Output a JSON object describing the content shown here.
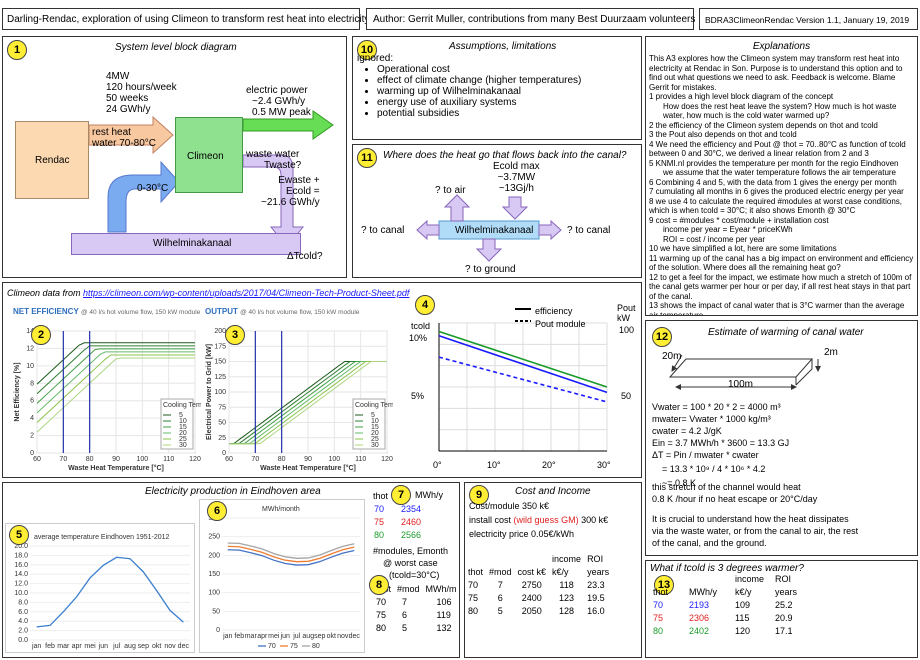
{
  "header": {
    "title": "Darling-Rendac, exploration of using Climeon to transform rest heat into electricity",
    "author": "Author: Gerrit Muller, contributions from many Best Duurzaam volunteers",
    "version": "BDRA3ClimeonRendac Version 1.1, January 19, 2019"
  },
  "block": {
    "num": "1",
    "title": "System level block diagram",
    "rendac": "Rendac",
    "climeon": "Climeon",
    "wilhelmina": "Wilhelminakanaal",
    "input": [
      "4MW",
      "120 hours/week",
      "50 weeks",
      "24 GWh/y"
    ],
    "elec": [
      "electric power",
      "~2.4 GWh/y",
      "0.5 MW peak"
    ],
    "restheat": [
      "rest heat",
      "water 70-80°C"
    ],
    "cold": "0-30°C",
    "waste": [
      "waste water",
      "Twaste?"
    ],
    "ewaste": [
      "Ewaste +",
      "Ecold =",
      "~21.6 GWh/y"
    ],
    "dtcold": "ΔTcold?"
  },
  "assumptions": {
    "num": "10",
    "title": "Assumptions, limitations",
    "lead": "ignored:",
    "items": [
      "Operational cost",
      "effect of climate change (higher temperatures)",
      "warming up of Wilhelminakanaal",
      "energy use of auxiliary systems",
      "potential subsidies"
    ]
  },
  "where": {
    "num": "11",
    "title": "Where does the heat go that flows back into the canal?",
    "ecold": [
      "Ecold max",
      "~3.7MW",
      "~13Gj/h"
    ],
    "air": "? to air",
    "canal_left": "? to canal",
    "canal_right": "? to canal",
    "ground": "? to ground",
    "canal": "Wilhelminakanaal"
  },
  "explanations": {
    "title": "Explanations",
    "lines": [
      {
        "t": "This A3 explores how the Climeon system may transform rest heat into electricity at Rendac in Son. Purpose is to understand this option and to find out what questions we need to ask. Feedback is welcome. Blame Gerrit for mistakes.",
        "in": false
      },
      {
        "t": "1 provides a high level block diagram of the concept",
        "in": false
      },
      {
        "t": "How does the rest heat leave the system? How much is hot waste water, how much is the cold water warmed up?",
        "in": true
      },
      {
        "t": "2 the efficiency of the Climeon system depends on thot and tcold",
        "in": false
      },
      {
        "t": "3 the Pout also depends on thot and tcold",
        "in": false
      },
      {
        "t": "4 We need the efficiency and Pout @ thot = 70..80°C as function of tcold between 0 and 30°C, we derived a linear relation from 2 and 3",
        "in": false
      },
      {
        "t": "5 KNMI.nl provides the temperature per month for the regio Eindhoven",
        "in": false
      },
      {
        "t": "we assume that the water temperature follows the air temperature",
        "in": true
      },
      {
        "t": "6 Combining 4 and 5, with the data from 1 gives the energy per month",
        "in": false
      },
      {
        "t": "7 cumulating all months in 6 gives the produced electric energy per year",
        "in": false
      },
      {
        "t": "8 we use 4 to calculate the required #modules at worst case conditions, which is when tcold = 30°C; it also shows Emonth @ 30°C",
        "in": false
      },
      {
        "t": "9 cost = #modules * cost/module + installation cost",
        "in": false
      },
      {
        "t": "income per year = Eyear * priceKWh",
        "in": true
      },
      {
        "t": "ROI = cost / income per year",
        "in": true
      },
      {
        "t": "10 we have simplified a lot, here are some limitations",
        "in": false
      },
      {
        "t": "11 warming up of the canal has a big impact on environment and efficiency of the solution. Where does all the remaining heat go?",
        "in": false
      },
      {
        "t": "12 to get a feel for the impact, we estimate how much a stretch of 100m of the canal gets warmer per hour or per day, if all rest heat stays in that part of the canal.",
        "in": false
      },
      {
        "t": "13 shows the impact of canal water that is 3°C warmer than the average air temperature",
        "in": false
      }
    ]
  },
  "climeon": {
    "source_label": "Climeon data from",
    "source_url": "https://climeon.com/wp-content/uploads/2017/04/Climeon-Tech-Product-Sheet.pdf",
    "net_title": "NET EFFICIENCY",
    "net_sub": "@ 40 l/s hot volume flow, 150 kW module",
    "out_title": "OUTPUT",
    "out_sub": "@ 40 l/s hot volume flow, 150 kW module",
    "num2": "2",
    "num3": "3",
    "net_ylabel": "Net Efficiency [%]",
    "out_ylabel": "Electrical Power to Grid [kW]",
    "xlabel": "Waste Heat Temperature [°C]",
    "legend_title": "Cooling Temp. [°C]",
    "legend_items": [
      "5",
      "10",
      "15",
      "20",
      "25",
      "30"
    ]
  },
  "linear": {
    "num": "4",
    "tcold": "tcold",
    "pout": "Pout",
    "kw": "kW",
    "leg_eff": "efficiency",
    "leg_pout": "Pout module",
    "y_ticks": [
      "10%",
      "5%"
    ],
    "y2_ticks": [
      "100",
      "50"
    ],
    "x_ticks": [
      "0°",
      "10°",
      "20°",
      "30°"
    ]
  },
  "canal": {
    "num": "12",
    "title": "Estimate of warming of canal water",
    "d20": "20m",
    "d2": "2m",
    "d100": "100m",
    "calc": [
      "Vwater = 100 * 20 * 2 = 4000 m³",
      "mwater= Vwater * 1000 kg/m³",
      "cwater = 4.2 J/gK",
      "Ein = 3.7 MWh/h * 3600 = 13.3 GJ",
      "ΔT = Pin / mwater * cwater",
      "= 13.3 * 10⁹ / 4 * 10⁶ * 4.2",
      "~= 0.8 K"
    ],
    "stretch": [
      "this stretch of the channel would heat",
      "0.8 K /hour if no heat escape or 20°C/day"
    ],
    "crucial": [
      "It is crucial to understand how the heat dissipates",
      "via the waste water, or from the canal to air, the rest",
      "of the canal, and the ground."
    ]
  },
  "eindhoven": {
    "title": "Electricity production in Eindhoven area",
    "num5": "5",
    "num6": "6",
    "num7": "7",
    "num8": "8",
    "temp_title": "average temperature Eindhoven 1951-2012",
    "mwh_title": "MWh/month",
    "months": [
      "jan",
      "feb",
      "mar",
      "apr",
      "mei",
      "jun",
      "jul",
      "aug",
      "sep",
      "okt",
      "nov",
      "dec"
    ],
    "thot_h": "thot",
    "mwhy_h": "MWh/y",
    "yearly": [
      [
        "70",
        "2354"
      ],
      [
        "75",
        "2460"
      ],
      [
        "80",
        "2566"
      ]
    ],
    "modules_title": [
      "#modules, Emonth",
      "@ worst case",
      "(tcold=30°C)"
    ],
    "mod_h": [
      "thot",
      "#mod",
      "MWh/m"
    ],
    "mod_rows": [
      [
        "70",
        "7",
        "106"
      ],
      [
        "75",
        "6",
        "119"
      ],
      [
        "80",
        "5",
        "132"
      ]
    ]
  },
  "cost": {
    "num": "9",
    "title": "Cost and Income",
    "module": "Cost/module 350 k€",
    "install_a": "install cost",
    "install_b": "(wild guess GM)",
    "install_c": "300 k€",
    "price": "electricity price 0.05€/kWh",
    "h1": [
      "",
      "",
      "",
      "income",
      "ROI"
    ],
    "h2": [
      "thot",
      "#mod",
      "cost k€",
      "k€/y",
      "years"
    ],
    "rows": [
      [
        "70",
        "7",
        "2750",
        "118",
        "23.3"
      ],
      [
        "75",
        "6",
        "2400",
        "123",
        "19.5"
      ],
      [
        "80",
        "5",
        "2050",
        "128",
        "16.0"
      ]
    ]
  },
  "warmer": {
    "num": "13",
    "title": "What if tcold is 3 degrees warmer?",
    "h1": [
      "",
      "",
      "income",
      "ROI"
    ],
    "h2": [
      "thot",
      "MWh/y",
      "k€/y",
      "years"
    ],
    "rows": [
      [
        "70",
        "2193",
        "109",
        "25.2"
      ],
      [
        "75",
        "2306",
        "115",
        "20.9"
      ],
      [
        "80",
        "2402",
        "120",
        "17.1"
      ]
    ]
  },
  "chart_data": [
    {
      "type": "line",
      "title": "average temperature Eindhoven 1951-2012",
      "categories": [
        "jan",
        "feb",
        "mar",
        "apr",
        "mei",
        "jun",
        "jul",
        "aug",
        "sep",
        "okt",
        "nov",
        "dec"
      ],
      "values": [
        2.8,
        3.1,
        6.0,
        9.2,
        13.2,
        15.9,
        17.6,
        17.3,
        14.5,
        10.5,
        6.3,
        3.8
      ],
      "ylim": [
        0,
        20
      ]
    },
    {
      "type": "line",
      "title": "MWh/month",
      "categories": [
        "jan",
        "feb",
        "mar",
        "apr",
        "mei",
        "jun",
        "jul",
        "aug",
        "sep",
        "okt",
        "nov",
        "dec"
      ],
      "series": [
        {
          "name": "70",
          "values": [
            215,
            214,
            207,
            199,
            187,
            178,
            174,
            175,
            183,
            195,
            206,
            213
          ]
        },
        {
          "name": "75",
          "values": [
            224,
            223,
            216,
            208,
            196,
            187,
            183,
            184,
            192,
            204,
            215,
            222
          ]
        },
        {
          "name": "80",
          "values": [
            233,
            232,
            225,
            217,
            205,
            196,
            192,
            193,
            201,
            213,
            224,
            231
          ]
        }
      ],
      "ylim": [
        0,
        300
      ]
    },
    {
      "type": "line",
      "title": "",
      "x": [
        0,
        30
      ],
      "series": [
        {
          "name": "efficiency 80",
          "values": [
            11.2,
            6.0
          ]
        },
        {
          "name": "efficiency 70",
          "values": [
            10.8,
            5.5
          ]
        },
        {
          "name": "Pout module 75",
          "values": [
            88,
            46
          ]
        }
      ],
      "xlim": [
        0,
        30
      ],
      "ylim": [
        0,
        12
      ]
    }
  ]
}
